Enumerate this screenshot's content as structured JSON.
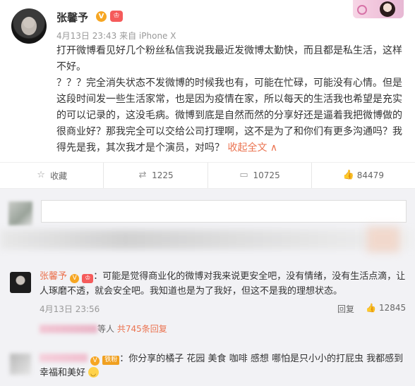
{
  "post": {
    "author": "张馨予",
    "verified_badge": "V",
    "member_badge": "♔",
    "meta": "4月13日 23:43 来自 iPhone X",
    "paragraph1": "打开微博看见好几个粉丝私信我说我最近发微博太勤快，而且都是私生活，这样不好。",
    "paragraph2": "？？？完全消失状态不发微博的时候我也有，可能在忙碌，可能没有心情。但是这段时间发一些生活家常，也是因为疫情在家，所以每天的生活我也希望是充实的可以记录的，这没毛病。微博到底是自然而然的分享好还是逼着我把微博做的很商业好？那我完全可以交给公司打理啊，这不是为了和你们有更多沟通吗？我得先是我，其次我才是个演员，对吗？",
    "collapse_label": "收起全文 ∧"
  },
  "actions": {
    "favorite_label": "收藏",
    "repost_count": "1225",
    "comment_count": "10725",
    "like_count": "84479"
  },
  "icons": {
    "star": "☆",
    "repost": "⇄",
    "comment": "▭",
    "like": "👍"
  },
  "reply": {
    "name": "张馨予",
    "text": "：可能是觉得商业化的微博对我来说更安全吧，没有情绪，没有生活点滴，让人琢磨不透，就会安全吧。我知道也是为了我好，但这不是我的理想状态。",
    "time": "4月13日 23:56",
    "reply_label": "回复",
    "like_count": "12845"
  },
  "more": {
    "suffix": "等人",
    "link": "共745条回复"
  },
  "sub": {
    "fan_badge": "铁粉",
    "text": "：你分享的橘子 花园 美食 咖啡 感想 哪怕是只小小的打屁虫 我都感到幸福和美好"
  },
  "colors": {
    "accent": "#eb7350",
    "background": "#f2f2f5"
  }
}
